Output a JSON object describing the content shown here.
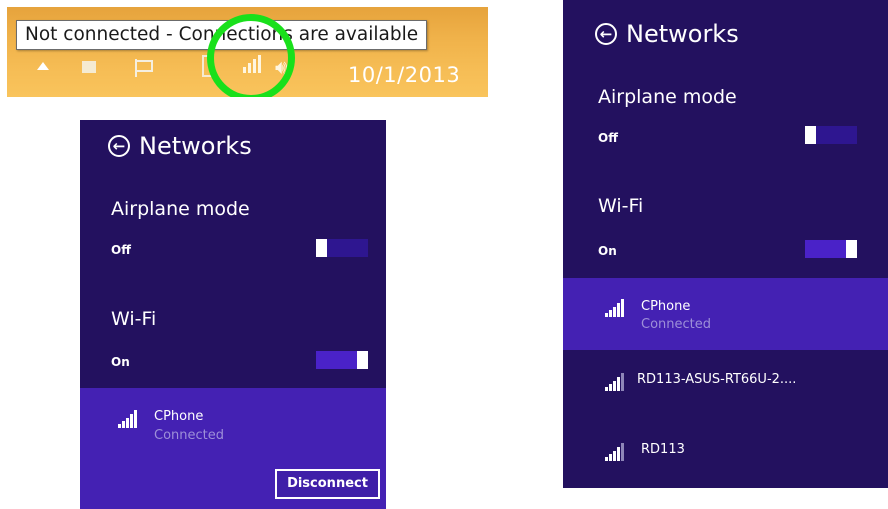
{
  "taskbar": {
    "tooltip": "Not connected - Connections are available",
    "date": "10/1/2013",
    "icons": [
      "show-hidden-icons-icon",
      "tray-app-icon",
      "action-center-flag-icon",
      "tray-device-icon",
      "network-signal-icon",
      "speaker-icon"
    ],
    "highlight_color": "#19e01b"
  },
  "panel_small": {
    "title": "Networks",
    "airplane": {
      "label": "Airplane mode",
      "state": "Off"
    },
    "wifi": {
      "label": "Wi-Fi",
      "state": "On"
    },
    "network": {
      "name": "CPhone",
      "status": "Connected"
    },
    "disconnect_label": "Disconnect"
  },
  "panel_large": {
    "title": "Networks",
    "airplane": {
      "label": "Airplane mode",
      "state": "Off"
    },
    "wifi": {
      "label": "Wi-Fi",
      "state": "On"
    },
    "networks": [
      {
        "name": "CPhone",
        "status": "Connected"
      },
      {
        "name": "RD113-ASUS-RT66U-2...."
      },
      {
        "name": "RD113"
      }
    ]
  },
  "colors": {
    "panel_bg": "#23115f",
    "selected_bg": "#4421b3",
    "status_text": "#9d8fd8"
  }
}
